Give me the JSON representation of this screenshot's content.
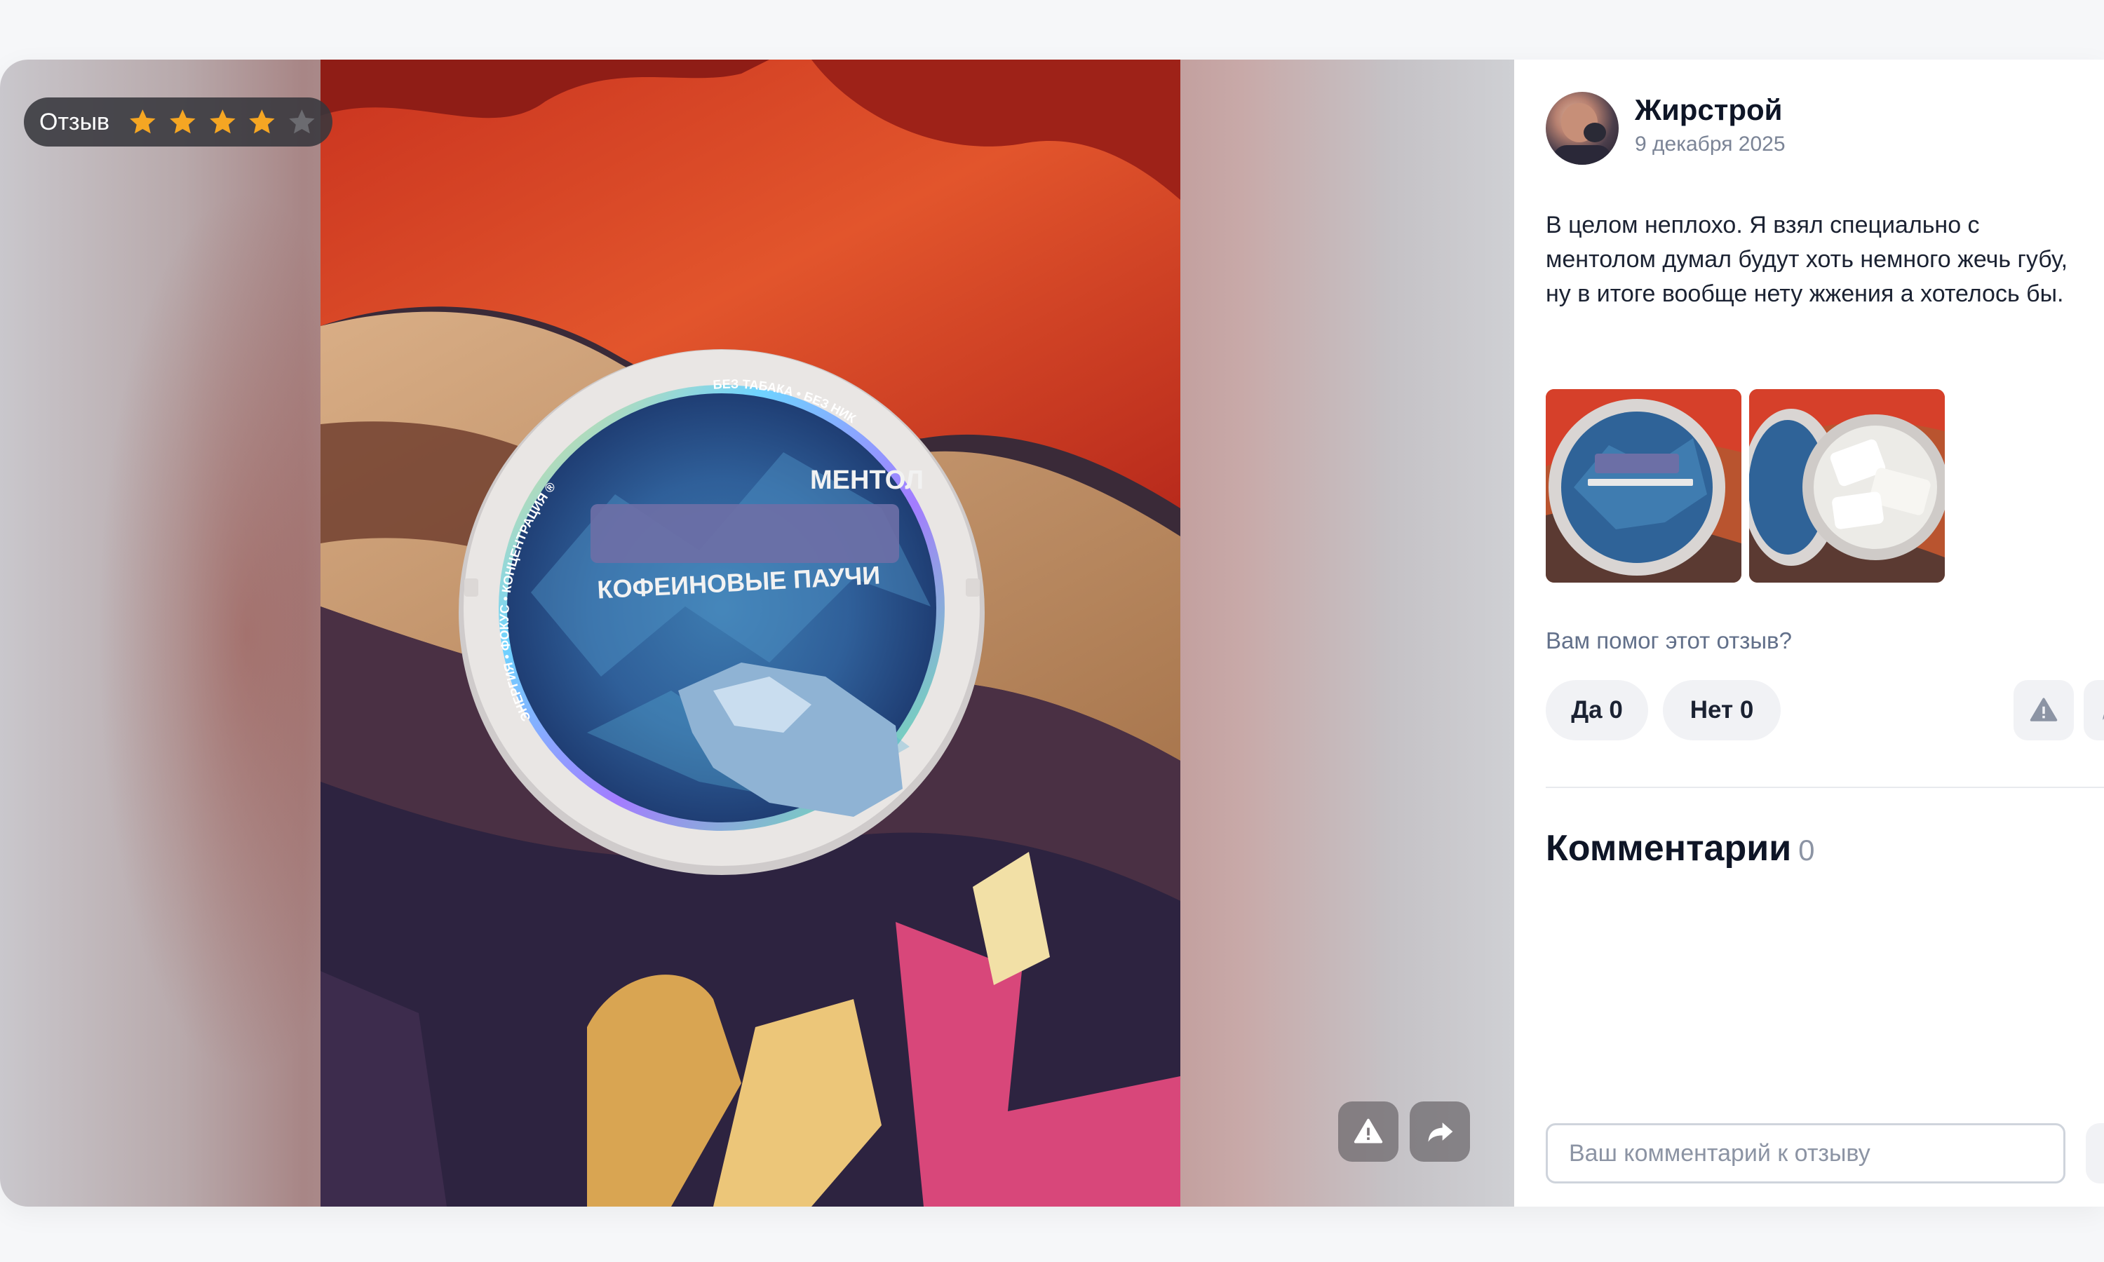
{
  "review": {
    "badge_label": "Отзыв",
    "rating": 4,
    "rating_max": 5,
    "author": "Жирстрой",
    "date": "9 декабря 2025",
    "text": "В целом неплохо. Я взял специально с ментолом думал будут хоть немного жечь губу, ну в итоге вообще нету жжения а хотелось бы."
  },
  "product_photo": {
    "flavor": "МЕНТОЛ",
    "product_name": "КОФЕИНОВЫЕ ПАУЧИ",
    "ring_text_left": "ЭНЕРГИЯ • ФОКУС • КОНЦЕНТРАЦИЯ ®",
    "ring_text_top": "БЕЗ ТАБАКА • БЕЗ НИКОТИНА"
  },
  "feedback": {
    "question": "Вам помог этот отзыв?",
    "yes_label": "Да 0",
    "no_label": "Нет 0"
  },
  "comments": {
    "title": "Комментарии",
    "count": "0",
    "input_placeholder": "Ваш комментарий к отзыву"
  },
  "colors": {
    "star_filled": "#f5a623",
    "star_empty": "#6b6b70",
    "title_text": "#0e1526",
    "muted_text": "#7b8496"
  },
  "icons": [
    "star-icon",
    "warning-icon",
    "share-icon",
    "close-icon"
  ]
}
